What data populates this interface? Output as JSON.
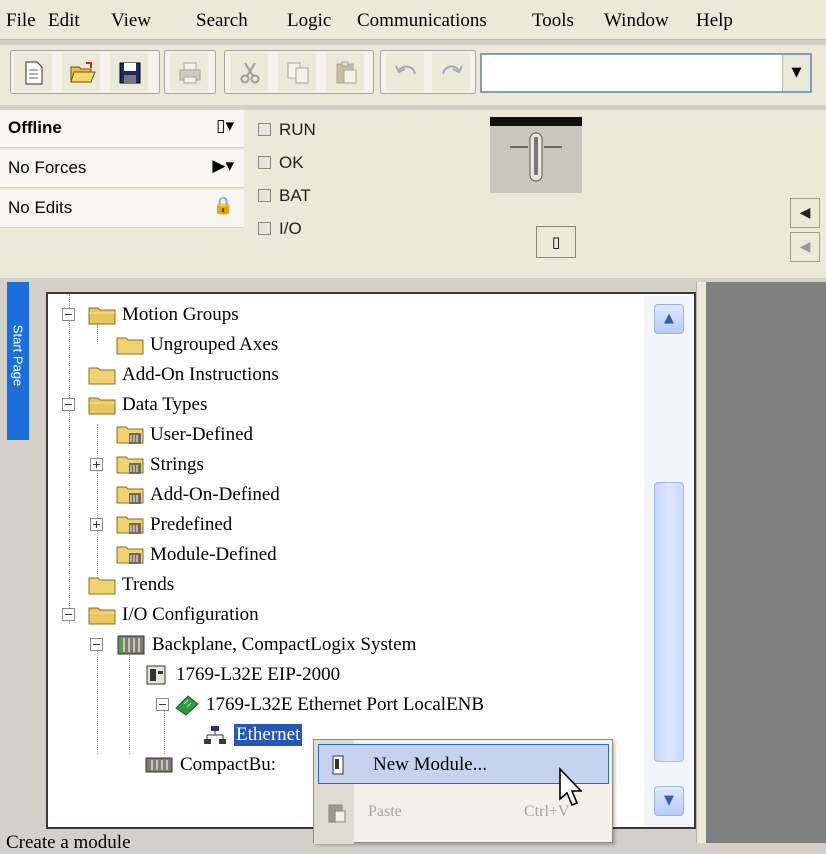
{
  "menu": [
    "File",
    "Edit",
    "View",
    "Search",
    "Logic",
    "Communications",
    "Tools",
    "Window",
    "Help"
  ],
  "toolbar": {
    "buttons": [
      "new-icon",
      "open-icon",
      "save-icon",
      "print-icon",
      "cut-icon",
      "copy-icon",
      "paste-icon",
      "undo-icon",
      "redo-icon"
    ],
    "combo_value": ""
  },
  "controller_status": {
    "mode": "Offline",
    "forces": "No Forces",
    "edits": "No Edits",
    "indicators": [
      "RUN",
      "OK",
      "BAT",
      "I/O"
    ]
  },
  "side_tab": "Start Page",
  "tree": [
    {
      "label": "Motion Groups",
      "icon": "folder-open-icon",
      "expander": "−"
    },
    {
      "label": "Ungrouped Axes",
      "icon": "folder-icon",
      "expander": ""
    },
    {
      "label": "Add-On Instructions",
      "icon": "folder-icon",
      "expander": ""
    },
    {
      "label": "Data Types",
      "icon": "folder-open-icon",
      "expander": "−"
    },
    {
      "label": "User-Defined",
      "icon": "datatype-icon",
      "expander": ""
    },
    {
      "label": "Strings",
      "icon": "datatype-icon",
      "expander": "+"
    },
    {
      "label": "Add-On-Defined",
      "icon": "datatype-icon",
      "expander": ""
    },
    {
      "label": "Predefined",
      "icon": "datatype-icon",
      "expander": "+"
    },
    {
      "label": "Module-Defined",
      "icon": "datatype-icon",
      "expander": ""
    },
    {
      "label": "Trends",
      "icon": "folder-icon",
      "expander": ""
    },
    {
      "label": "I/O Configuration",
      "icon": "folder-open-icon",
      "expander": "−"
    },
    {
      "label": "Backplane, CompactLogix System",
      "icon": "backplane-icon",
      "expander": "−"
    },
    {
      "label": "1769-L32E EIP-2000",
      "icon": "controller-icon",
      "expander": ""
    },
    {
      "label": "1769-L32E Ethernet Port LocalENB",
      "icon": "ethernet-port-icon",
      "expander": "−"
    },
    {
      "label": "Ethernet",
      "icon": "network-icon",
      "expander": ""
    },
    {
      "label": "CompactBu:",
      "icon": "bus-icon",
      "expander": ""
    }
  ],
  "context_menu": {
    "new_module": "New Module...",
    "paste": "Paste",
    "paste_shortcut": "Ctrl+V"
  },
  "status_bar": "Create a module"
}
